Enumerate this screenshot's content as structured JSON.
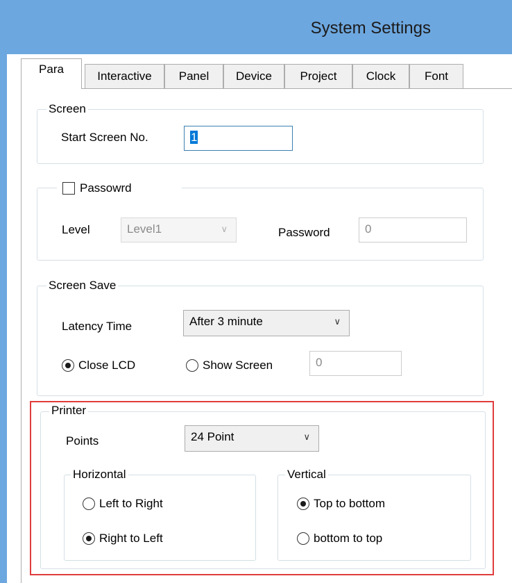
{
  "window": {
    "title": "System Settings"
  },
  "tabs": [
    {
      "label": "Para",
      "active": true
    },
    {
      "label": "Interactive"
    },
    {
      "label": "Panel"
    },
    {
      "label": "Device"
    },
    {
      "label": "Project"
    },
    {
      "label": "Clock"
    },
    {
      "label": "Font"
    }
  ],
  "screen": {
    "group_label": "Screen",
    "start_label": "Start Screen No.",
    "start_value": "1"
  },
  "password": {
    "checkbox_label": "Passowrd",
    "checked": false,
    "level_label": "Level",
    "level_value": "Level1",
    "password_label": "Password",
    "password_value": "0"
  },
  "screen_save": {
    "group_label": "Screen Save",
    "latency_label": "Latency Time",
    "latency_value": "After 3 minute",
    "close_lcd_label": "Close LCD",
    "close_lcd_selected": true,
    "show_screen_label": "Show Screen",
    "show_screen_value": "0"
  },
  "printer": {
    "group_label": "Printer",
    "points_label": "Points",
    "points_value": "24 Point",
    "horizontal": {
      "group_label": "Horizontal",
      "left_to_right": "Left to Right",
      "right_to_left": "Right to Left",
      "selected": "right_to_left"
    },
    "vertical": {
      "group_label": "Vertical",
      "top_to_bottom": "Top to bottom",
      "bottom_to_top": "bottom to top",
      "selected": "top_to_bottom"
    }
  },
  "colors": {
    "titlebar": "#6da7df",
    "highlight_border": "#e03c3c",
    "selection": "#0078d7"
  }
}
